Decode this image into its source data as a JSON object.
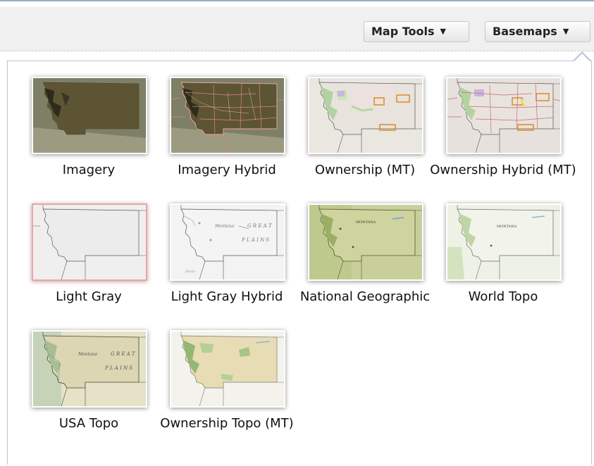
{
  "toolbar": {
    "map_tools_label": "Map Tools",
    "map_tools_arrow": "▼",
    "basemaps_label": "Basemaps",
    "basemaps_arrow": "▼"
  },
  "basemaps": {
    "selected": "Light Gray",
    "items": [
      {
        "label": "Imagery",
        "style": "imagery"
      },
      {
        "label": "Imagery Hybrid",
        "style": "imagery-hybrid"
      },
      {
        "label": "Ownership (MT)",
        "style": "ownership"
      },
      {
        "label": "Ownership Hybrid (MT)",
        "style": "ownership-hybrid"
      },
      {
        "label": "Light Gray",
        "style": "light-gray"
      },
      {
        "label": "Light Gray Hybrid",
        "style": "light-gray-hybrid"
      },
      {
        "label": "National Geographic",
        "style": "natgeo"
      },
      {
        "label": "World Topo",
        "style": "world-topo"
      },
      {
        "label": "USA Topo",
        "style": "usa-topo"
      },
      {
        "label": "Ownership Topo (MT)",
        "style": "ownership-topo"
      }
    ]
  },
  "thumb_text": {
    "montana": "Montana",
    "great": "G R E A T",
    "plains": "P L A I N S",
    "idaho": "Idaho",
    "montana_caps": "MONTANA"
  },
  "colors": {
    "imagery_land": "#5d5434",
    "imagery_bg": "#8a8a70",
    "light_gray_bg": "#efefef",
    "natgeo_bg": "#c9cf9a",
    "world_topo_bg": "#eef2e6",
    "ownership_bg": "#eae6e0",
    "selected_border": "#e8a6a8"
  }
}
